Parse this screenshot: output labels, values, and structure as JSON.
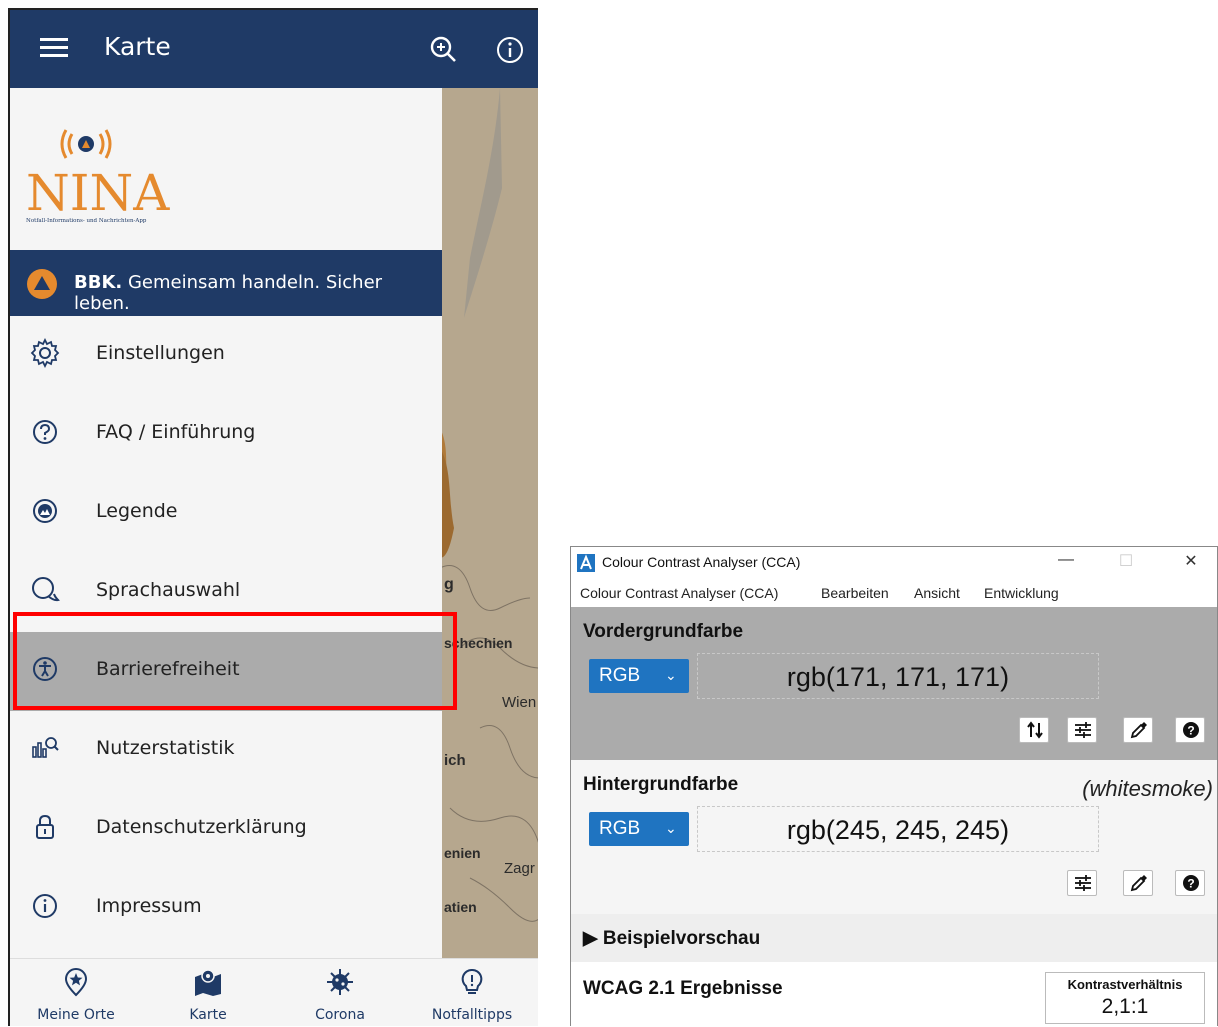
{
  "phone": {
    "title": "Karte",
    "brand_colors": {
      "primary": "#1f3a66",
      "accent": "#e58a2e",
      "drawer_bg": "#f5f5f5",
      "selected_bg": "#ababab",
      "highlight": "#ff0000"
    },
    "logo": {
      "text": "NINA",
      "subtitle": "Notfall-Informations- und Nachrichten-App"
    },
    "bbk_banner": {
      "bold": "BBK.",
      "text": " Gemeinsam handeln. Sicher leben."
    },
    "menu": [
      {
        "label": "Einstellungen",
        "icon": "gear-icon"
      },
      {
        "label": "FAQ / Einführung",
        "icon": "question-icon"
      },
      {
        "label": "Legende",
        "icon": "legend-icon"
      },
      {
        "label": "Sprachauswahl",
        "icon": "chat-icon"
      },
      {
        "label": "Barrierefreiheit",
        "icon": "accessibility-icon",
        "selected": true
      },
      {
        "label": "Nutzerstatistik",
        "icon": "statistics-icon"
      },
      {
        "label": "Datenschutzerklärung",
        "icon": "lock-icon"
      },
      {
        "label": "Impressum",
        "icon": "info-icon"
      }
    ],
    "map_labels": [
      "g",
      "schechien",
      "Wien",
      "ich",
      "enien",
      "Zagr",
      "atien"
    ],
    "tabs": [
      {
        "label": "Meine Orte",
        "icon": "star-pin-icon"
      },
      {
        "label": "Karte",
        "icon": "map-icon"
      },
      {
        "label": "Corona",
        "icon": "virus-icon"
      },
      {
        "label": "Notfalltipps",
        "icon": "lightbulb-icon"
      }
    ]
  },
  "cca": {
    "window_title": "Colour Contrast Analyser (CCA)",
    "menu": [
      "Colour Contrast Analyser (CCA)",
      "Bearbeiten",
      "Ansicht",
      "Entwicklung"
    ],
    "foreground": {
      "label": "Vordergrundfarbe",
      "format": "RGB",
      "value": "rgb(171, 171, 171)",
      "color": "#ababab"
    },
    "background": {
      "label": "Hintergrundfarbe",
      "name": "(whitesmoke)",
      "format": "RGB",
      "value": "rgb(245, 245, 245)",
      "color": "#f5f5f5"
    },
    "preview_label": "▶  Beispielvorschau",
    "wcag": {
      "label": "WCAG 2.1 Ergebnisse",
      "ratio_label": "Kontrastverhältnis",
      "ratio_value": "2,1:1"
    }
  }
}
